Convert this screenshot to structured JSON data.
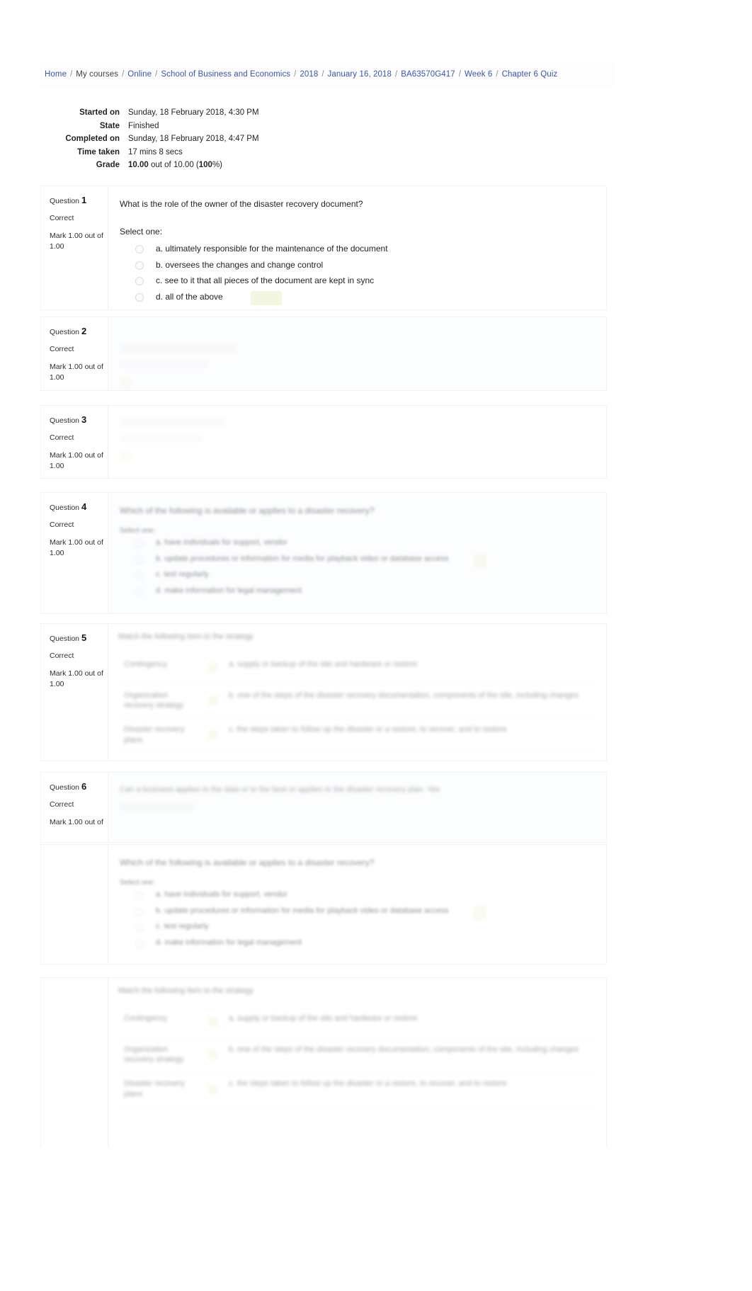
{
  "breadcrumb": {
    "separator": "/",
    "items": [
      {
        "label": "Home",
        "link": true
      },
      {
        "label": "My courses",
        "link": false
      },
      {
        "label": "Online",
        "link": true
      },
      {
        "label": "School of Business and Economics",
        "link": true
      },
      {
        "label": "2018",
        "link": true
      },
      {
        "label": "January 16, 2018",
        "link": true
      },
      {
        "label": "BA63570G417",
        "link": true
      },
      {
        "label": "Week 6",
        "link": true
      },
      {
        "label": "Chapter 6 Quiz",
        "link": true
      }
    ]
  },
  "summary": {
    "rows": [
      {
        "label": "Started on",
        "value": "Sunday, 18 February 2018, 4:30 PM"
      },
      {
        "label": "State",
        "value": "Finished"
      },
      {
        "label": "Completed on",
        "value": "Sunday, 18 February 2018, 4:47 PM"
      },
      {
        "label": "Time taken",
        "value": "17 mins 8 secs"
      }
    ],
    "grade": {
      "label": "Grade",
      "score": "10.00",
      "mid": " out of 10.00 (",
      "percent": "100",
      "end": "%)"
    }
  },
  "questions": [
    {
      "number_label": "Question",
      "number": "1",
      "state": "Correct",
      "mark": "Mark 1.00 out of 1.00",
      "text": "What is the role of the owner of the disaster recovery document?",
      "select_label": "Select one:",
      "answers": [
        {
          "label": "a. ultimately responsible for the maintenance of the document",
          "correct": false
        },
        {
          "label": "b. oversees the changes and change control",
          "correct": false
        },
        {
          "label": "c. see to it that all pieces of the document are kept in sync",
          "correct": false
        },
        {
          "label": "d. all of the above",
          "correct": true
        }
      ]
    },
    {
      "number_label": "Question",
      "number": "2",
      "state": "Correct",
      "mark": "Mark 1.00 out of 1.00",
      "text": "",
      "select_label": "",
      "answers": []
    },
    {
      "number_label": "Question",
      "number": "3",
      "state": "Correct",
      "mark": "Mark 1.00 out of 1.00",
      "text": "",
      "select_label": "",
      "answers": []
    },
    {
      "number_label": "Question",
      "number": "4",
      "state": "Correct",
      "mark": "Mark 1.00 out of 1.00",
      "text": "Which of the following is available or applies to a disaster recovery?",
      "select_label": "Select one:",
      "answers": [
        {
          "label": "a. have individuals for support, vendor",
          "correct": false
        },
        {
          "label": "b. update procedures or information for media for playback video or database access",
          "correct": true
        },
        {
          "label": "c. test regularly",
          "correct": false
        },
        {
          "label": "d. make information for legal management",
          "correct": false
        }
      ]
    },
    {
      "number_label": "Question",
      "number": "5",
      "state": "Correct",
      "mark": "Mark 1.00 out of 1.00",
      "text": "Match the following item to the strategy",
      "select_label": "",
      "pairs": [
        {
          "left": "Contingency",
          "right": "a. supply or backup of the site and hardware or restore"
        },
        {
          "left": "Organization recovery strategy",
          "right": "b. one of the steps of the disaster recovery documentation, components of the site, including changes"
        },
        {
          "left": "Disaster recovery plans",
          "right": "c. the steps taken to follow up the disaster or a restore, to recover, and to restore"
        }
      ]
    },
    {
      "number_label": "Question",
      "number": "6",
      "state": "Correct",
      "mark": "Mark 1.00 out of",
      "text": "Can a business applies to the data or to the best or applies to the disaster recovery plan. Yes",
      "select_label": "",
      "answers": []
    }
  ],
  "repeat_blocks": [
    {
      "text": "Which of the following is available or applies to a disaster recovery?",
      "select_label": "Select one:",
      "answers": [
        {
          "label": "a. have individuals for support, vendor",
          "correct": false
        },
        {
          "label": "b. update procedures or information for media for playback video or database access",
          "correct": true
        },
        {
          "label": "c. test regularly",
          "correct": false
        },
        {
          "label": "d. make information for legal management",
          "correct": false
        }
      ]
    },
    {
      "text": "Match the following item to the strategy",
      "pairs": [
        {
          "left": "Contingency",
          "right": "a. supply or backup of the site and hardware or restore"
        },
        {
          "left": "Organization recovery strategy",
          "right": "b. one of the steps of the disaster recovery documentation, components of the site, including changes"
        },
        {
          "left": "Disaster recovery plans",
          "right": "c. the steps taken to follow up the disaster or a restore, to recover, and to restore"
        }
      ]
    }
  ],
  "colors": {
    "link": "#3a53b0",
    "text": "#1d2125",
    "correct_highlight": "#f2f4da",
    "border": "#eef4f7"
  }
}
